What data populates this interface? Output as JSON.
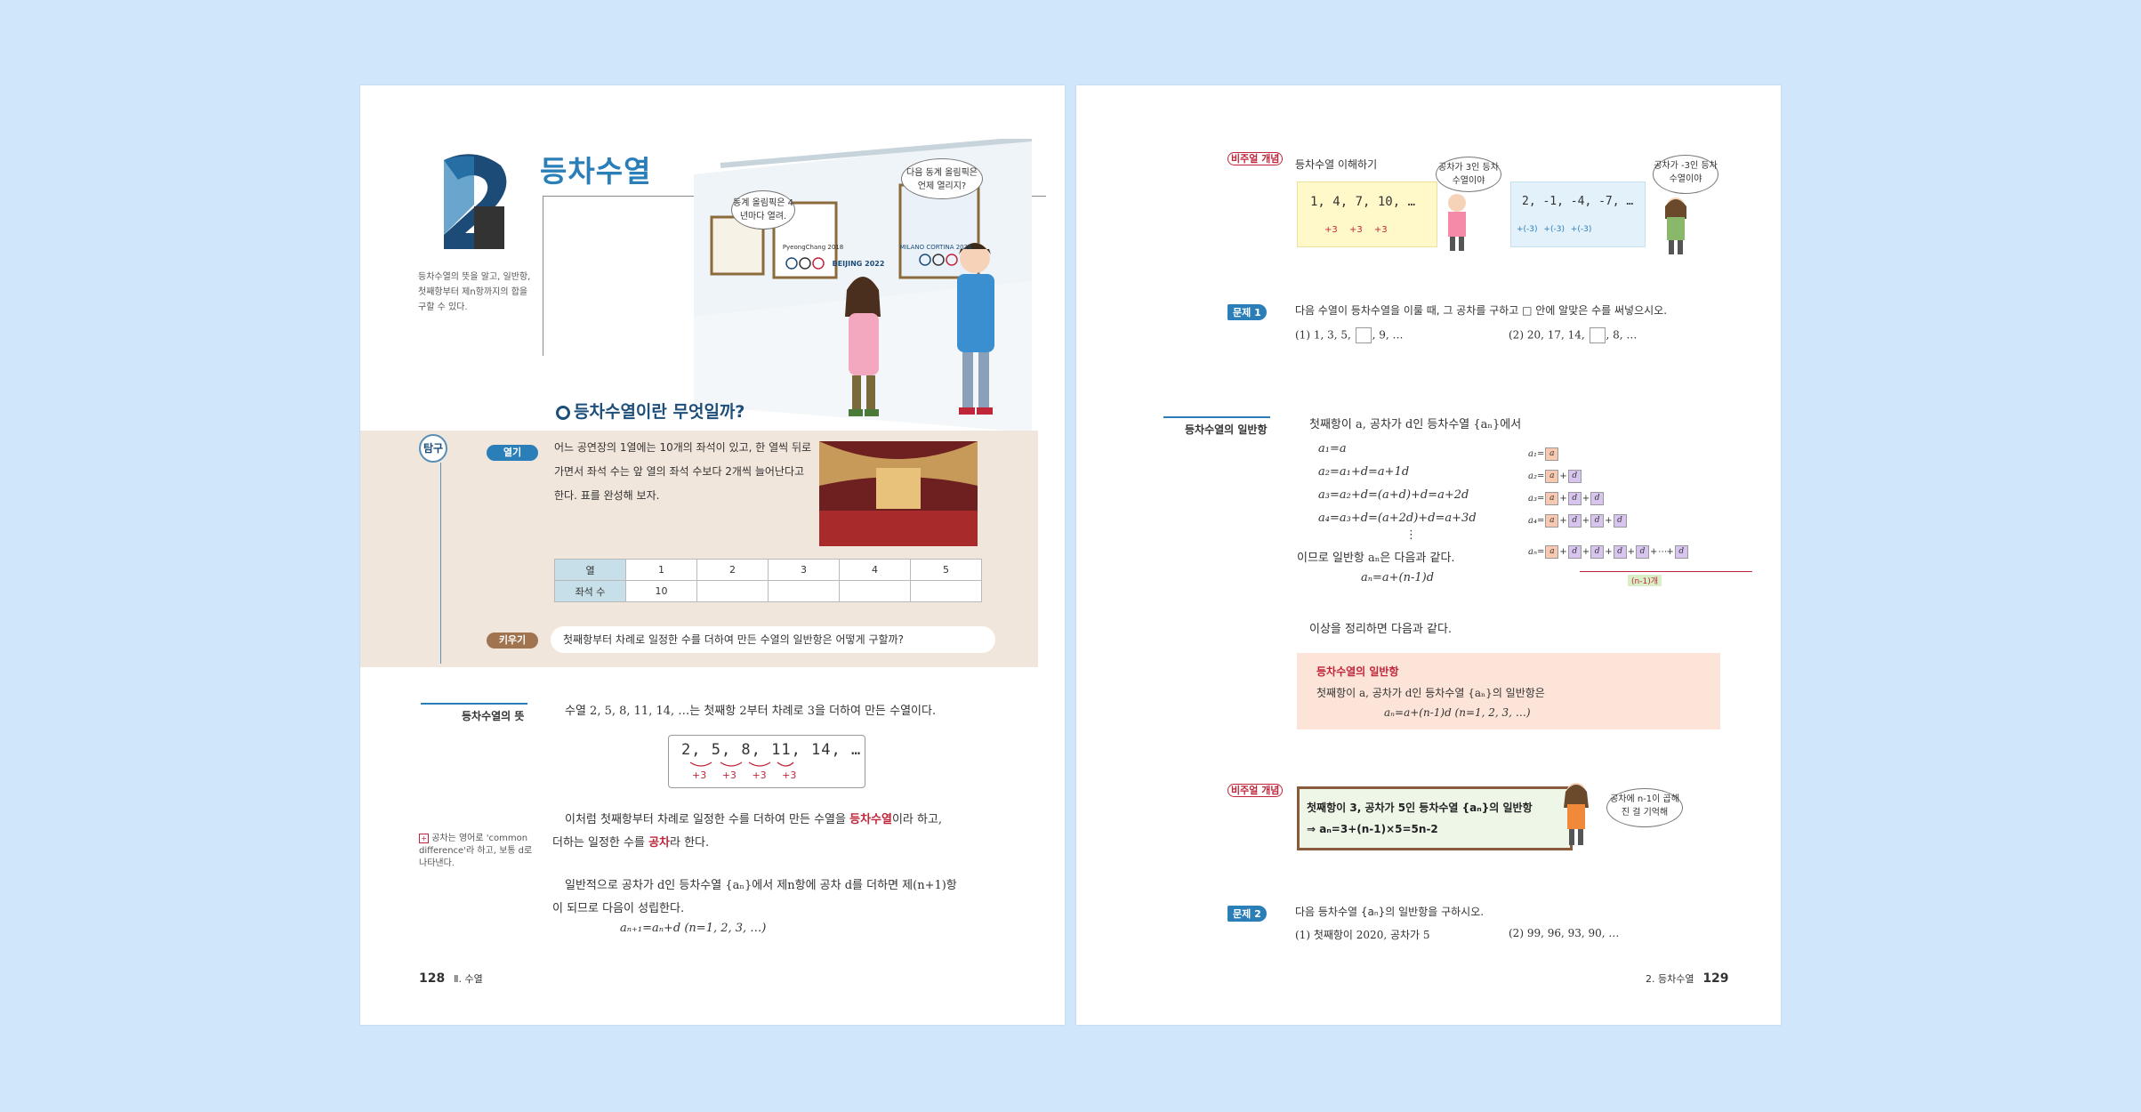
{
  "left_page": {
    "chapter_number": "2",
    "section_title": "등차수열",
    "objective": "등차수열의 뜻을 알고, 일반항, 첫째항부터 제n항까지의 합을 구할 수 있다.",
    "illustration": {
      "speech_girl": "동계 올림픽은 4년마다 열려.",
      "speech_boy": "다음 동계 올림픽은 언제 열리지?",
      "poster_1": "PyeongChang 2018",
      "poster_2": "BEIJING 2022",
      "poster_3": "MILANO CORTINA 2026"
    },
    "inquiry": {
      "label": "탐구",
      "heading": "등차수열이란 무엇일까?",
      "open_badge": "열기",
      "open_text_line1": "어느 공연장의 1열에는 10개의 좌석이 있고, 한 열씩 뒤로",
      "open_text_line2": "가면서 좌석 수는 앞 열의 좌석 수보다 2개씩 늘어난다고",
      "open_text_line3": "한다. 표를 완성해 보자.",
      "table": {
        "row1_header": "열",
        "row1": [
          "1",
          "2",
          "3",
          "4",
          "5"
        ],
        "row2_header": "좌석 수",
        "row2": [
          "10",
          "",
          "",
          "",
          ""
        ]
      },
      "grow_badge": "키우기",
      "grow_text": "첫째항부터 차례로 일정한 수를 더하여 만든 수열의 일반항은 어떻게 구할까?"
    },
    "definition": {
      "side_label": "등차수열의 뜻",
      "line1": "수열 2, 5, 8, 11, 14, …는 첫째항 2부터 차례로 3을 더하여 만든 수열이다.",
      "seq_box": "2, 5, 8, 11, 14, …",
      "seq_diffs": [
        "+3",
        "+3",
        "+3",
        "+3"
      ],
      "line2a": "이처럼 첫째항부터 차례로 일정한 수를 더하여 만든 수열을 ",
      "term1": "등차수열",
      "line2b": "이라 하고,",
      "line3a": "더하는 일정한 수를 ",
      "term2": "공차",
      "line3b": "라 한다.",
      "note": "공차는 영어로 'common difference'라 하고, 보통 d로 나타낸다.",
      "line4": "일반적으로 공차가 d인 등차수열 {aₙ}에서 제n항에 공차 d를 더하면 제(n+1)항",
      "line5": "이 되므로 다음이 성립한다.",
      "formula": "aₙ₊₁=aₙ+d (n=1, 2, 3, …)"
    },
    "page_number": "128",
    "footer_label": "Ⅱ. 수열"
  },
  "right_page": {
    "visual_logo": "비주얼 개념",
    "visual_title": "등차수열 이해하기",
    "seq_a": "1, 4, 7, 10, …",
    "seq_a_diffs": [
      "+3",
      "+3",
      "+3"
    ],
    "bubble_a": "공차가 3인 등차수열이야",
    "seq_b": "2, -1, -4, -7, …",
    "seq_b_diffs": [
      "+(-3)",
      "+(-3)",
      "+(-3)"
    ],
    "bubble_b": "공차가 -3인 등차수열이야",
    "problem1": {
      "badge": "문제 1",
      "text": "다음 수열이 등차수열을 이룰 때, 그 공차를 구하고 □ 안에 알맞은 수를 써넣으시오.",
      "item1_a": "(1) 1, 3, 5, ",
      "item1_b": ", 9, …",
      "item2_a": "(2) 20, 17, 14, ",
      "item2_b": ", 8, …"
    },
    "general_term": {
      "side_label": "등차수열의 일반항",
      "intro": "첫째항이 a, 공차가 d인 등차수열 {aₙ}에서",
      "eq1": "a₁=a",
      "eq2": "a₂=a₁+d=a+1d",
      "eq3": "a₃=a₂+d=(a+d)+d=a+2d",
      "eq4": "a₄=a₃+d=(a+2d)+d=a+3d",
      "dots": "⋮",
      "conclude": "이므로 일반항 aₙ은 다음과 같다.",
      "result": "aₙ=a+(n-1)d",
      "diagram_labels": [
        "a₁=",
        "a₂=",
        "a₃=",
        "a₄=",
        "aₙ="
      ],
      "diagram_brace": "(n-1)개",
      "summary_intro": "이상을 정리하면 다음과 같다.",
      "box_title": "등차수열의 일반항",
      "box_line1": "첫째항이 a, 공차가 d인 등차수열 {aₙ}의 일반항은",
      "box_line2": "aₙ=a+(n-1)d (n=1, 2, 3, …)"
    },
    "visual2": {
      "logo": "비주얼 개념",
      "board_line1": "첫째항이 3, 공차가 5인 등차수열 {aₙ}의 일반항",
      "board_line2": "⇒ aₙ=3+(n-1)×5=5n-2",
      "bubble": "공차에 n-1이 곱해진 걸 기억해"
    },
    "problem2": {
      "badge": "문제 2",
      "text": "다음 등차수열 {aₙ}의 일반항을 구하시오.",
      "item1": "(1) 첫째항이 2020, 공차가 5",
      "item2": "(2) 99, 96, 93, 90, …"
    },
    "footer_label": "2. 등차수열",
    "page_number": "129"
  },
  "colors": {
    "accent_blue": "#2b7fb8",
    "term_red": "#c0263a",
    "inquiry_bg": "#f1e6dc",
    "summary_bg": "#fde4d8"
  }
}
